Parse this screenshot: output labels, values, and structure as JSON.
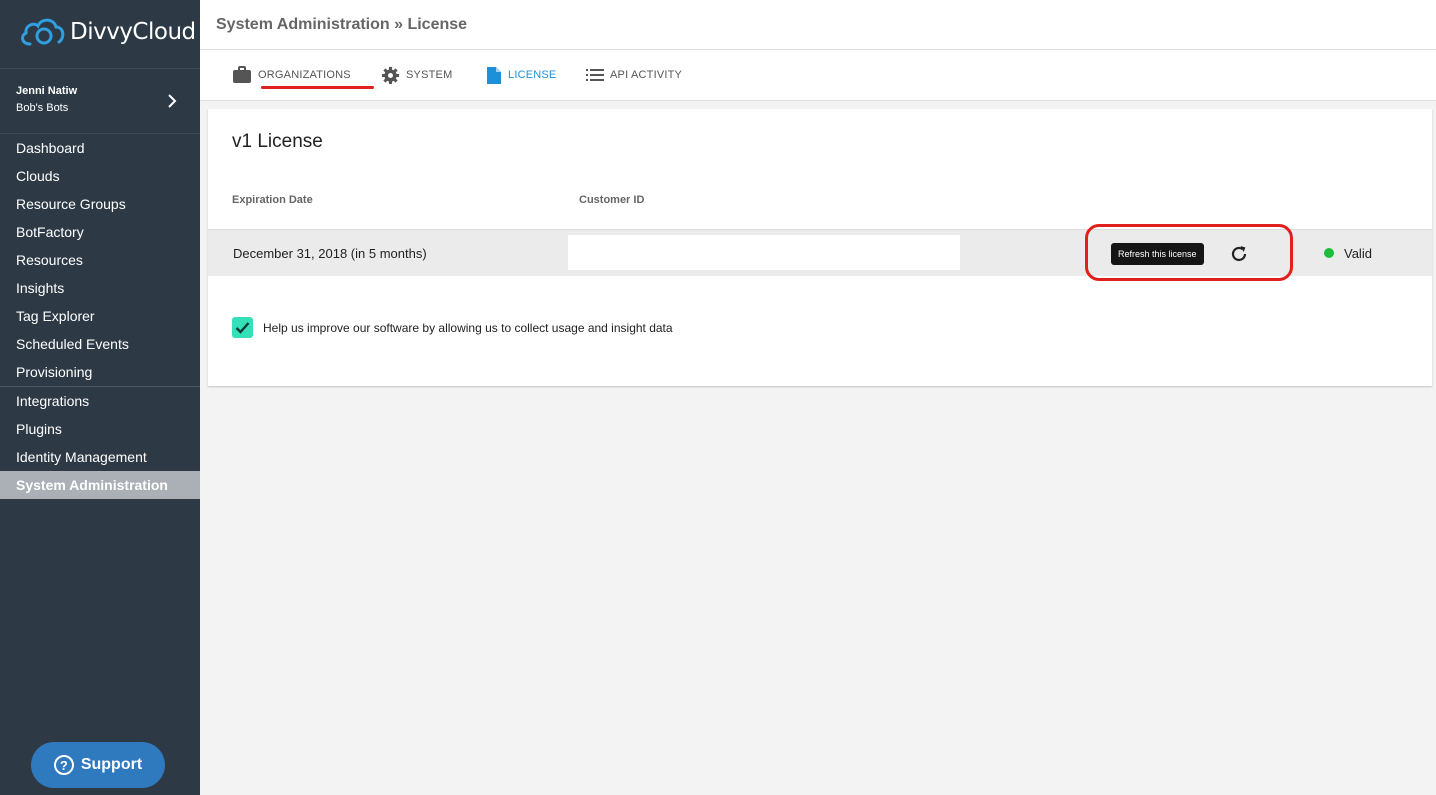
{
  "brand": {
    "name": "DivvyCloud",
    "accent": "#2f79bf"
  },
  "user": {
    "name": "Jenni Natiw",
    "org": "Bob's Bots"
  },
  "sidebar": {
    "items": [
      {
        "label": "Dashboard"
      },
      {
        "label": "Clouds"
      },
      {
        "label": "Resource Groups"
      },
      {
        "label": "BotFactory"
      },
      {
        "label": "Resources"
      },
      {
        "label": "Insights"
      },
      {
        "label": "Tag Explorer"
      },
      {
        "label": "Scheduled Events"
      },
      {
        "label": "Provisioning"
      },
      {
        "label": "Integrations"
      },
      {
        "label": "Plugins"
      },
      {
        "label": "Identity Management"
      },
      {
        "label": "System Administration"
      }
    ],
    "active": "System Administration",
    "support_label": "Support"
  },
  "header": {
    "breadcrumb": "System Administration » License"
  },
  "tabs": [
    {
      "label": "ORGANIZATIONS",
      "icon": "briefcase-icon"
    },
    {
      "label": "SYSTEM",
      "icon": "gear-icon"
    },
    {
      "label": "LICENSE",
      "icon": "document-icon",
      "active": true
    },
    {
      "label": "API ACTIVITY",
      "icon": "list-icon"
    }
  ],
  "license": {
    "title": "v1 License",
    "columns": {
      "expiration": "Expiration Date",
      "customer": "Customer ID"
    },
    "expiration_value": "December 31, 2018 (in 5 months)",
    "customer_id": "",
    "tooltip": "Refresh this license",
    "status": "Valid",
    "status_color": "#1bbd3a"
  },
  "consent": {
    "checked": true,
    "label": "Help us improve our software by allowing us to collect usage and insight data"
  }
}
